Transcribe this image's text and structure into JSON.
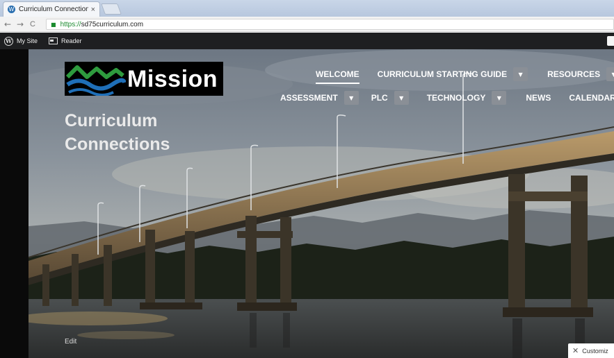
{
  "browser": {
    "tab_title": "Curriculum Connections",
    "tab_close": "×",
    "url_scheme": "https://",
    "url_host": "sd75curriculum.com",
    "back_icon": "←",
    "forward_icon": "→",
    "reload_icon": "C"
  },
  "admin_bar": {
    "my_site": "My Site",
    "reader": "Reader"
  },
  "site": {
    "logo_text": "Mission",
    "title_line1": "Curriculum",
    "title_line2": "Connections"
  },
  "nav": {
    "row1": [
      {
        "label": "WELCOME",
        "active": true,
        "dropdown": false
      },
      {
        "label": "CURRICULUM STARTING GUIDE",
        "active": false,
        "dropdown": true
      },
      {
        "label": "RESOURCES",
        "active": false,
        "dropdown": true
      }
    ],
    "row2": [
      {
        "label": "ASSESSMENT",
        "active": false,
        "dropdown": true
      },
      {
        "label": "PLC",
        "active": false,
        "dropdown": true
      },
      {
        "label": "TECHNOLOGY",
        "active": false,
        "dropdown": true
      },
      {
        "label": "NEWS",
        "active": false,
        "dropdown": false
      },
      {
        "label": "CALENDAR",
        "active": false,
        "dropdown": false
      }
    ],
    "dropdown_icon": "▼"
  },
  "footer": {
    "edit": "Edit",
    "customize": "Customiz"
  },
  "colors": {
    "admin_bar": "#1e1f21",
    "logo_blue": "#1f6fb8",
    "logo_green": "#2e9b3e"
  }
}
